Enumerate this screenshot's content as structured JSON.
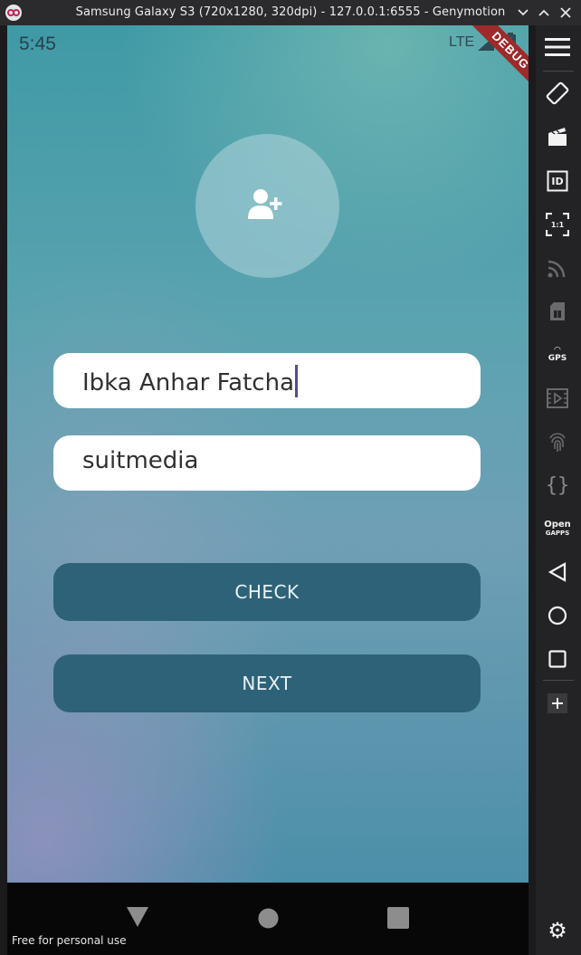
{
  "window": {
    "title": "Samsung Galaxy S3 (720x1280, 320dpi) - 127.0.0.1:6555 - Genymotion"
  },
  "statusbar": {
    "time": "5:45",
    "network": "LTE"
  },
  "debug_banner": "DEBUG",
  "form": {
    "name_value": "Ibka Anhar Fatcha",
    "palindrome_value": "suitmedia",
    "check_label": "CHECK",
    "next_label": "NEXT"
  },
  "watermark": "Free for personal use",
  "toolbar": {
    "gps_label": "GPS",
    "id_label": "ID",
    "open_label": "Open",
    "gapps_label": "GAPPS",
    "ratio_label": "1:1"
  },
  "colors": {
    "button": "#2e6279",
    "input_bg": "#ffffff",
    "debug_ribbon": "#9e2a2a"
  }
}
